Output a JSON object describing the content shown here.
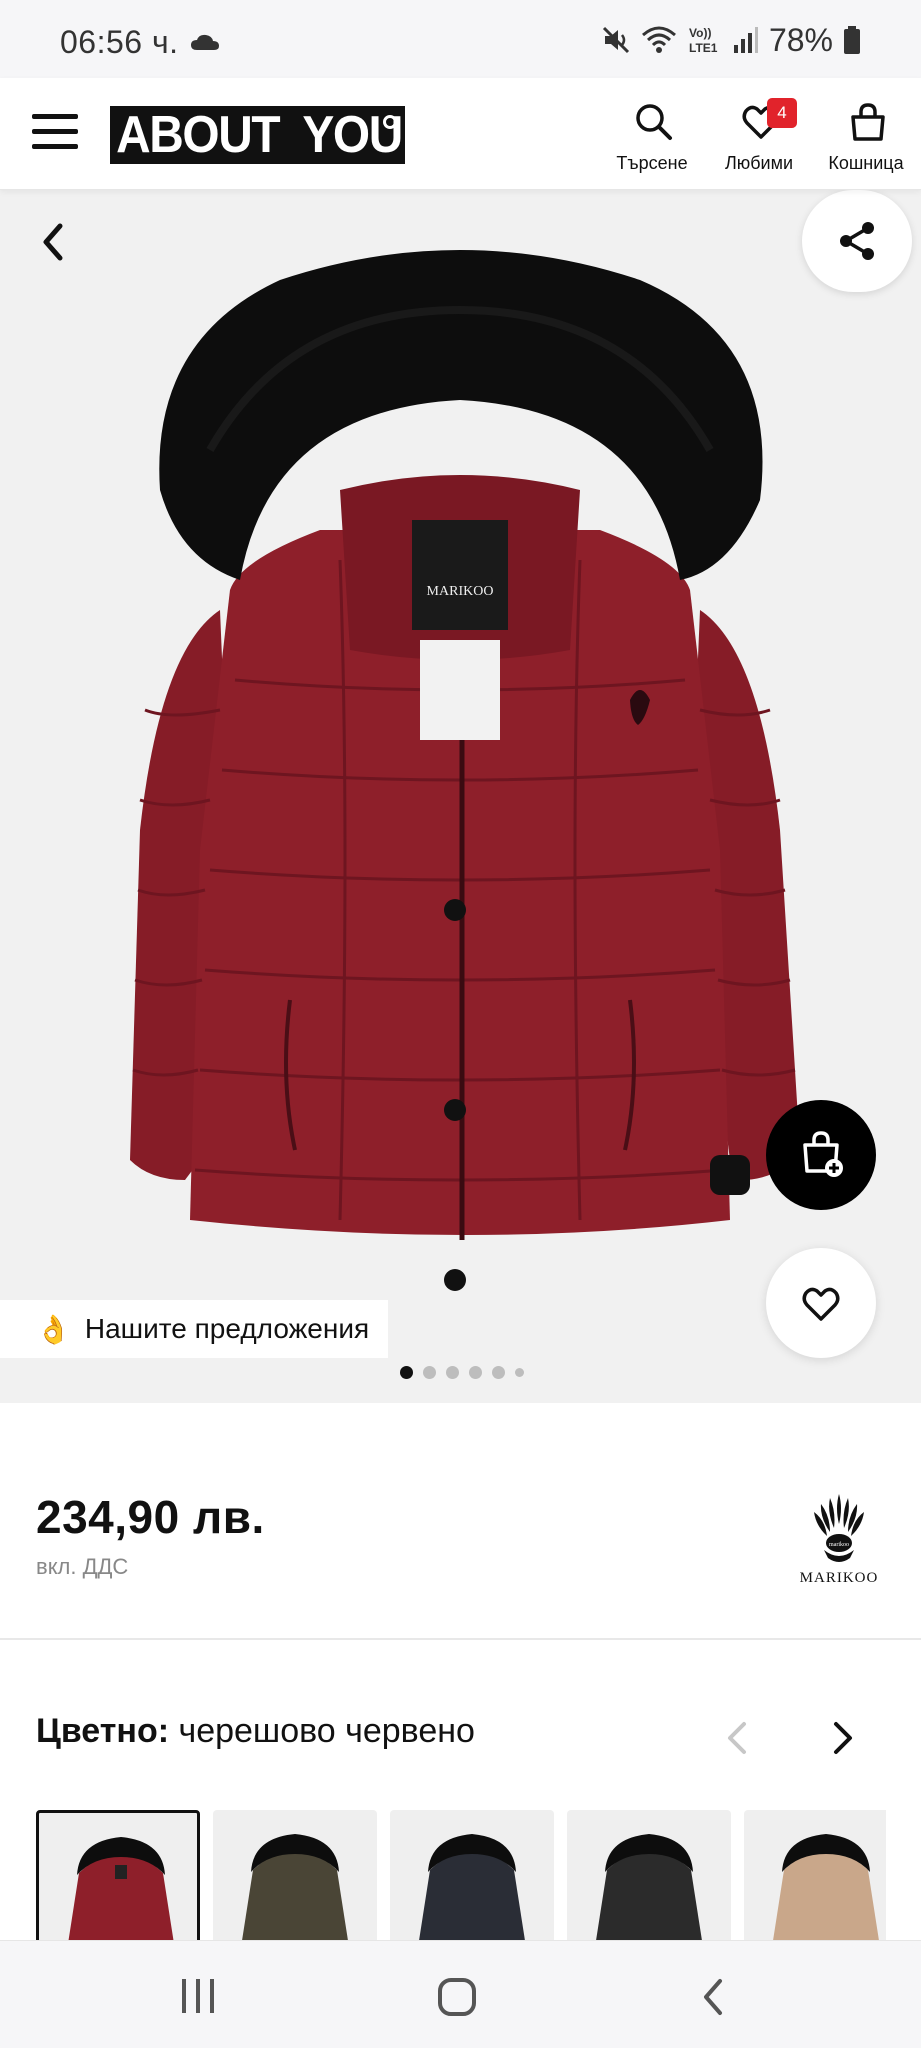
{
  "status_bar": {
    "time": "06:56 ч.",
    "battery": "78%",
    "icons": [
      "cloud-icon",
      "mute-icon",
      "wifi-icon",
      "volte-icon",
      "signal-icon",
      "battery-icon"
    ],
    "volte_label": "Vo)) LTE1"
  },
  "header": {
    "logo_left": "ABOUT",
    "logo_right": "YOU",
    "actions": [
      {
        "label": "Търсене",
        "icon": "search-icon"
      },
      {
        "label": "Любими",
        "icon": "heart-icon",
        "badge": "4"
      },
      {
        "label": "Кошница",
        "icon": "bag-icon"
      }
    ]
  },
  "gallery": {
    "offers_label": "Нашите предложения",
    "offers_emoji": "👌",
    "image_count": 6,
    "active_index": 0
  },
  "product": {
    "price": "234,90 лв.",
    "vat": "вкл. ДДС",
    "brand": "MARIKOO",
    "color_key": "Цветно:",
    "color_value": "черешово червено",
    "swatch_colors": [
      "#8e1f2a",
      "#4a4536",
      "#2a2d36",
      "#2b2b2b",
      "#c9a78a"
    ]
  },
  "colors": {
    "accent_badge": "#e1232b",
    "jacket": "#8e1f2a",
    "fur": "#0d0d0d"
  }
}
